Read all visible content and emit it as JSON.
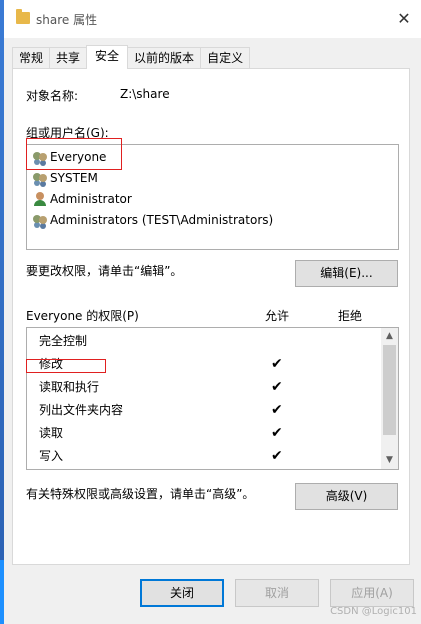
{
  "window": {
    "title": "share 属性",
    "close_label": "✕"
  },
  "tabs": [
    {
      "label": "常规",
      "active": false
    },
    {
      "label": "共享",
      "active": false
    },
    {
      "label": "安全",
      "active": true
    },
    {
      "label": "以前的版本",
      "active": false
    },
    {
      "label": "自定义",
      "active": false
    }
  ],
  "security": {
    "object_label": "对象名称:",
    "object_value": "Z:\\share",
    "group_label": "组或用户名(G):",
    "users": [
      {
        "name": "Everyone",
        "icon": "group-icon"
      },
      {
        "name": "SYSTEM",
        "icon": "group-icon"
      },
      {
        "name": "Administrator",
        "icon": "user-icon"
      },
      {
        "name": "Administrators (TEST\\Administrators)",
        "icon": "group-icon"
      }
    ],
    "change_text": "要更改权限，请单击“编辑”。",
    "edit_button": "编辑(E)...",
    "perm_title": "Everyone 的权限(P)",
    "allow_header": "允许",
    "deny_header": "拒绝",
    "permissions": [
      {
        "name": "完全控制",
        "allow": ""
      },
      {
        "name": "修改",
        "allow": "✔"
      },
      {
        "name": "读取和执行",
        "allow": "✔"
      },
      {
        "name": "列出文件夹内容",
        "allow": "✔"
      },
      {
        "name": "读取",
        "allow": "✔"
      },
      {
        "name": "写入",
        "allow": "✔"
      }
    ],
    "special_text": "有关特殊权限或高级设置，请单击“高级”。",
    "advanced_button": "高级(V)"
  },
  "footer": {
    "ok_button": "关闭",
    "cancel_button": "取消",
    "apply_button": "应用(A)"
  },
  "watermark": "CSDN @Logic101",
  "colors": {
    "highlight_box": "#e02020",
    "primary_border": "#0078d7"
  }
}
